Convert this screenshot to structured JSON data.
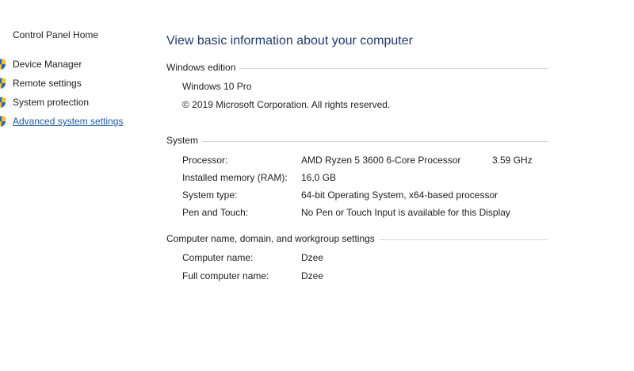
{
  "sidebar": {
    "home_label": "Control Panel Home",
    "items": [
      {
        "label": "Device Manager",
        "icon": "shield-icon"
      },
      {
        "label": "Remote settings",
        "icon": "shield-icon"
      },
      {
        "label": "System protection",
        "icon": "shield-icon"
      },
      {
        "label": "Advanced system settings",
        "icon": "shield-icon"
      }
    ]
  },
  "main": {
    "title": "View basic information about your computer",
    "windows_edition": {
      "heading": "Windows edition",
      "edition": "Windows 10 Pro",
      "copyright": "© 2019 Microsoft Corporation. All rights reserved."
    },
    "system": {
      "heading": "System",
      "rows": [
        {
          "key": "Processor:",
          "value": "AMD Ryzen 5 3600 6-Core Processor",
          "extra": "3.59 GHz"
        },
        {
          "key": "Installed memory (RAM):",
          "value": "16,0 GB"
        },
        {
          "key": "System type:",
          "value": "64-bit Operating System, x64-based processor"
        },
        {
          "key": "Pen and Touch:",
          "value": "No Pen or Touch Input is available for this Display"
        }
      ]
    },
    "computer": {
      "heading": "Computer name, domain, and workgroup settings",
      "rows": [
        {
          "key": "Computer name:",
          "value": "Dzee"
        },
        {
          "key": "Full computer name:",
          "value": "Dzee"
        }
      ]
    }
  },
  "colors": {
    "title": "#1f3b73",
    "link": "#1a5aa8",
    "rule": "#d6d6d6",
    "shield_blue": "#2b63c6",
    "shield_yellow": "#f0c419"
  }
}
